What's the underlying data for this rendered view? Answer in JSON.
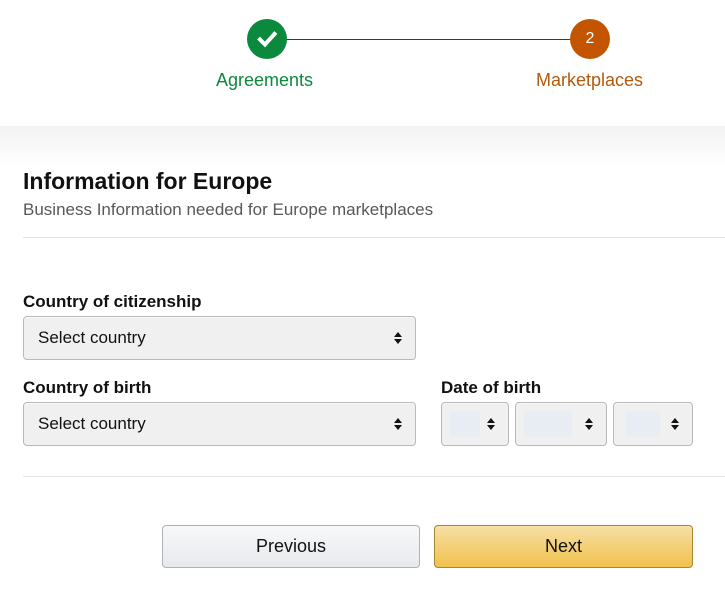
{
  "stepper": {
    "steps": [
      {
        "label": "Agreements",
        "state": "completed",
        "icon": "check-icon"
      },
      {
        "label": "Marketplaces",
        "state": "current",
        "number": "2"
      }
    ],
    "colors": {
      "completed": "#0b8a3e",
      "current": "#c45500"
    }
  },
  "section": {
    "title": "Information for Europe",
    "subtitle": "Business Information needed for Europe marketplaces"
  },
  "form": {
    "citizenship": {
      "label": "Country of citizenship",
      "value": "Select country"
    },
    "birth_country": {
      "label": "Country of birth",
      "value": "Select country"
    },
    "date_of_birth": {
      "label": "Date of birth",
      "day": "",
      "month": "",
      "year": ""
    }
  },
  "buttons": {
    "previous": "Previous",
    "next": "Next",
    "next_color": "#f0c14b"
  }
}
